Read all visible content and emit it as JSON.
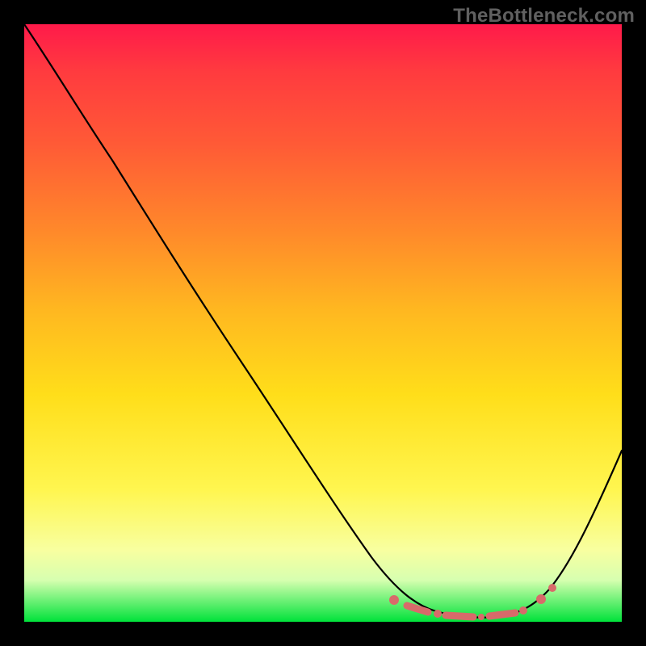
{
  "watermark": "TheBottleneck.com",
  "chart_data": {
    "type": "line",
    "title": "",
    "xlabel": "",
    "ylabel": "",
    "xlim": [
      0,
      100
    ],
    "ylim": [
      0,
      100
    ],
    "x": [
      0,
      5,
      10,
      15,
      20,
      25,
      30,
      35,
      40,
      45,
      50,
      55,
      60,
      65,
      70,
      75,
      80,
      85,
      90,
      95,
      100
    ],
    "values": [
      100,
      95,
      89,
      82,
      75,
      68,
      61,
      54,
      47,
      40,
      33,
      26,
      19,
      12,
      6,
      2,
      0,
      1,
      5,
      14,
      29
    ],
    "series": [
      {
        "name": "bottleneck-curve",
        "x": [
          0,
          5,
          10,
          15,
          20,
          25,
          30,
          35,
          40,
          45,
          50,
          55,
          60,
          65,
          70,
          75,
          80,
          85,
          90,
          95,
          100
        ],
        "values": [
          100,
          95,
          89,
          82,
          75,
          68,
          61,
          54,
          47,
          40,
          33,
          26,
          19,
          12,
          6,
          2,
          0,
          1,
          5,
          14,
          29
        ]
      }
    ],
    "annotations": {
      "optimal_band_markers_x": [
        63,
        67,
        70,
        73,
        76,
        79,
        82,
        85,
        88
      ]
    },
    "background_gradient_stops": [
      {
        "pos": 0.0,
        "color": "#ff1a4a"
      },
      {
        "pos": 0.4,
        "color": "#ff8a2a"
      },
      {
        "pos": 0.7,
        "color": "#ffde1a"
      },
      {
        "pos": 0.92,
        "color": "#f8ffa0"
      },
      {
        "pos": 1.0,
        "color": "#00e23a"
      }
    ]
  }
}
